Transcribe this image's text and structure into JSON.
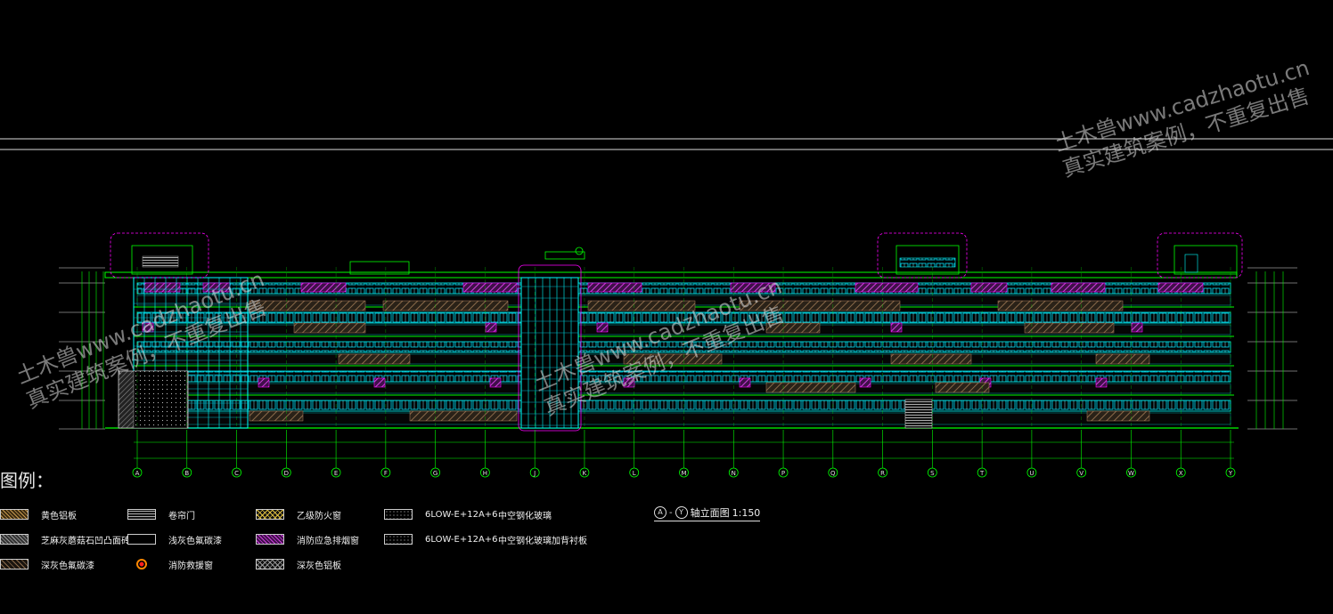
{
  "watermark": {
    "line1": "土木兽www.cadzhaotu.cn",
    "line2": "真实建筑案例，不重复出售"
  },
  "legend": {
    "title": "图例：",
    "items": [
      {
        "label": "黄色铝板",
        "pattern": "yellow-hatch"
      },
      {
        "label": "卷帘门",
        "pattern": "gray-lines"
      },
      {
        "label": "乙级防火窗",
        "pattern": "yellow-cross"
      },
      {
        "label": "6LOW-E+12A+6",
        "pattern": "dots"
      },
      {
        "label": "中空钢化玻璃",
        "pattern": "none"
      },
      {
        "label": "芝麻灰蘑菇石凹凸面砖",
        "pattern": "gray-stone"
      },
      {
        "label": "浅灰色氟碳漆",
        "pattern": "blank"
      },
      {
        "label": "消防应急排烟窗",
        "pattern": "magenta-hatch"
      },
      {
        "label": "6LOW-E+12A+6",
        "pattern": "dots"
      },
      {
        "label": "中空钢化玻璃加背衬板",
        "pattern": "none"
      },
      {
        "label": "深灰色氟碳漆",
        "pattern": "dark-hatch"
      },
      {
        "label": "消防救援窗",
        "pattern": "red-dot"
      },
      {
        "label": "深灰色铝板",
        "pattern": "gray-cross"
      }
    ]
  },
  "drawing_title": {
    "from_axis": "A",
    "to_axis": "Y",
    "text": "轴立面图",
    "scale": "1:150"
  },
  "axes": [
    "A",
    "B",
    "C",
    "D",
    "E",
    "F",
    "G",
    "H",
    "J",
    "K",
    "L",
    "M",
    "N",
    "P",
    "Q",
    "R",
    "S",
    "T",
    "U",
    "V",
    "W",
    "X",
    "Y"
  ],
  "colors": {
    "background": "#000000",
    "outline_green": "#00ff00",
    "glass_cyan": "#00ffff",
    "accent_magenta": "#ff00ff",
    "hatch_yellow": "#d4a84a"
  }
}
